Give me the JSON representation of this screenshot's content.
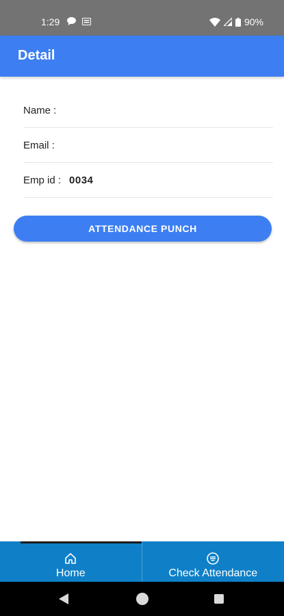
{
  "status_bar": {
    "time": "1:29",
    "battery": "90%"
  },
  "app_bar": {
    "title": "Detail"
  },
  "fields": [
    {
      "label": "Name :",
      "value": ""
    },
    {
      "label": "Email :",
      "value": ""
    },
    {
      "label": "Emp id :",
      "value": "0034"
    }
  ],
  "actions": {
    "punch_label": "ATTENDANCE PUNCH"
  },
  "bottom_nav": [
    {
      "label": "Home",
      "icon": "home-icon",
      "active": true
    },
    {
      "label": "Check Attendance",
      "icon": "list-icon",
      "active": false
    }
  ],
  "colors": {
    "primary": "#3d7ff2",
    "nav": "#0f80c8",
    "status": "#737373"
  }
}
